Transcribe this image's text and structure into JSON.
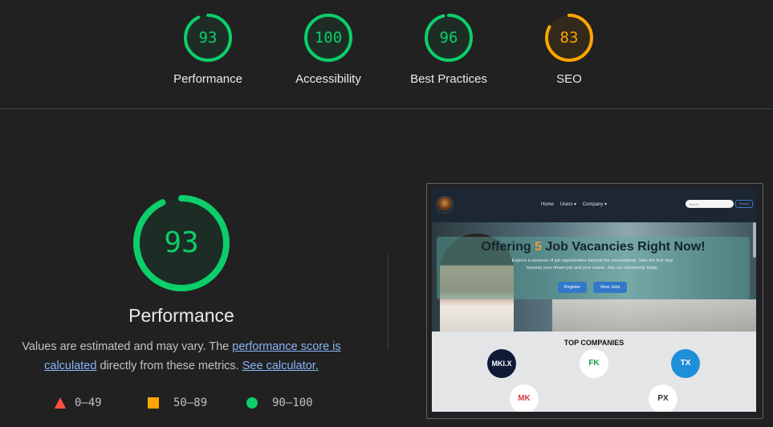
{
  "colors": {
    "pass": "#0cce6b",
    "average": "#ffa400",
    "fail": "#ff4e42",
    "link": "#8ab4f8"
  },
  "gauges": [
    {
      "id": "performance",
      "score": "93",
      "value": 93,
      "label": "Performance",
      "color": "#0cce6b"
    },
    {
      "id": "accessibility",
      "score": "100",
      "value": 100,
      "label": "Accessibility",
      "color": "#0cce6b"
    },
    {
      "id": "best-practices",
      "score": "96",
      "value": 96,
      "label": "Best Practices",
      "color": "#0cce6b"
    },
    {
      "id": "seo",
      "score": "83",
      "value": 83,
      "label": "SEO",
      "color": "#ffa400"
    }
  ],
  "main": {
    "score": "93",
    "value": 93,
    "title": "Performance",
    "desc_prefix": "Values are estimated and may vary. The ",
    "link1": "performance score is calculated",
    "desc_mid": " directly from these metrics. ",
    "link2": "See calculator."
  },
  "legend": [
    {
      "shape": "triangle",
      "range": "0–49"
    },
    {
      "shape": "square",
      "range": "50–89"
    },
    {
      "shape": "circle",
      "range": "90–100"
    }
  ],
  "screenshot": {
    "nav": {
      "home": "Home",
      "users": "Users ▾",
      "company": "Company ▾",
      "search_placeholder": "Search",
      "search_button": "Search"
    },
    "hero": {
      "title_a": "Offering ",
      "title_num": "5",
      "title_b": " Job Vacancies Right Now!",
      "subtitle": "Explore a universe of job opportunities beyond the conventional. Take the first step towards your dream job and your career. Join our community today.",
      "register": "Register",
      "view_jobs": "View Jobs"
    },
    "top_companies": "TOP COMPANIES",
    "companies": [
      "MKI.X",
      "FK",
      "TX",
      "MK",
      "PX"
    ]
  }
}
